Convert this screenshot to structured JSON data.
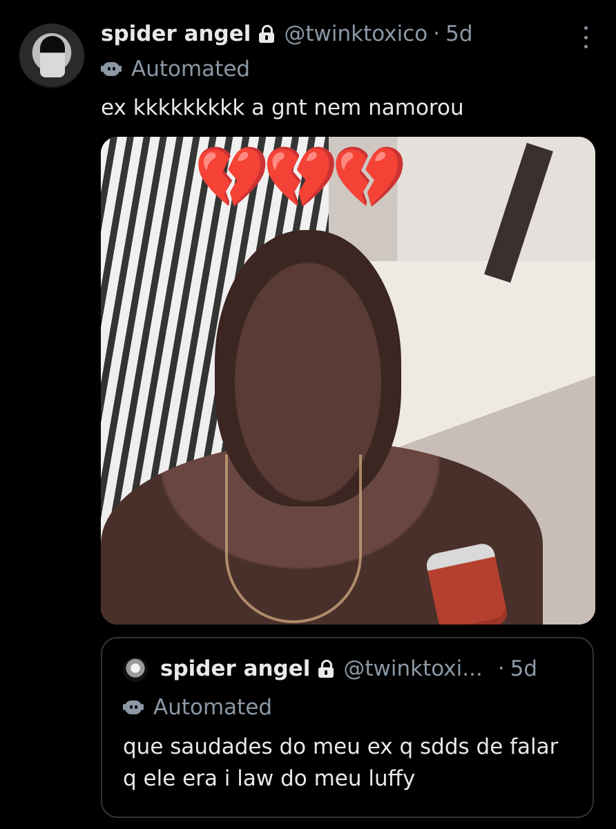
{
  "post": {
    "author_name": "spider angel",
    "handle": "@twinktoxico",
    "separator": "·",
    "time": "5d",
    "automated_label": "Automated",
    "text": "ex kkkkkkkkk a gnt nem namorou",
    "media": {
      "overlay_emoji": "💔💔💔"
    }
  },
  "quoted_post": {
    "author_name": "spider angel",
    "handle": "@twinktoxi...",
    "separator": "·",
    "time": "5d",
    "automated_label": "Automated",
    "text": "que saudades do meu ex q sdds de falar q ele era i law do meu luffy"
  },
  "icons": {
    "lock": "lock-icon",
    "automated": "robot-icon",
    "more": "more-options-icon"
  },
  "colors": {
    "background": "#000000",
    "primary_text": "#e7e9ea",
    "secondary_text": "#8b98a5",
    "border": "#2f3336",
    "heart": "#d63a44"
  }
}
